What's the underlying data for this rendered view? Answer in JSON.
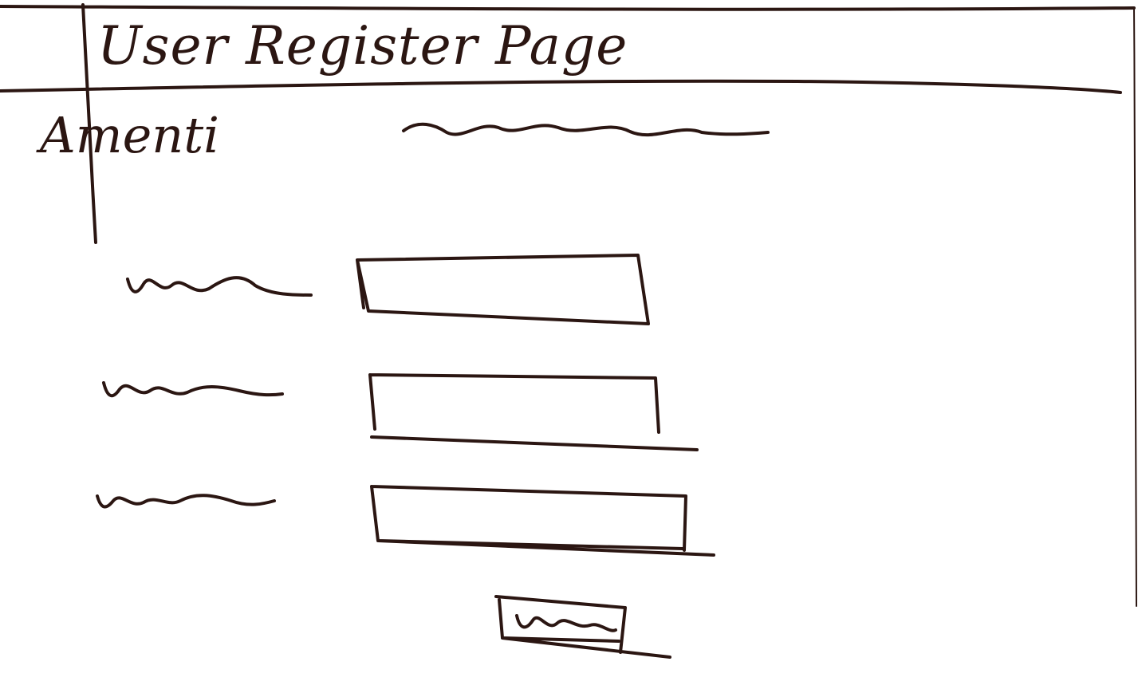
{
  "header": {
    "title": "User Register Page",
    "logo_text": "Amenti"
  },
  "form": {
    "fields": [
      {
        "label": "",
        "value": ""
      },
      {
        "label": "",
        "value": ""
      },
      {
        "label": "",
        "value": ""
      }
    ],
    "submit_label": ""
  },
  "colors": {
    "ink": "#2b1612",
    "paper": "#ffffff"
  }
}
